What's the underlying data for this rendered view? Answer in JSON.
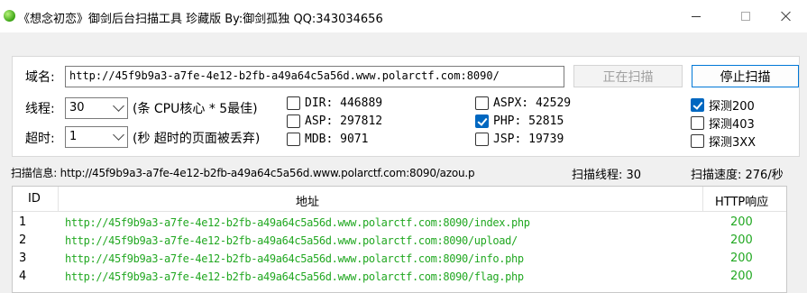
{
  "window": {
    "title": "《想念初恋》御剑后台扫描工具 珍藏版 By:御剑孤独 QQ:343034656"
  },
  "form": {
    "domain_label": "域名:",
    "domain_value": "http://45f9b9a3-a7fe-4e12-b2fb-a49a64c5a56d.www.polarctf.com:8090/",
    "scan_button": "正在扫描",
    "stop_button": "停止扫描",
    "threads_label": "线程:",
    "threads_value": "30",
    "threads_hint": "(条 CPU核心 * 5最佳)",
    "timeout_label": "超时:",
    "timeout_value": "1",
    "timeout_hint": "(秒 超时的页面被丢弃)"
  },
  "dictionaries": [
    {
      "label": "DIR: 446889",
      "checked": false
    },
    {
      "label": "ASP: 297812",
      "checked": false
    },
    {
      "label": "MDB: 9071",
      "checked": false
    },
    {
      "label": "ASPX: 42529",
      "checked": false
    },
    {
      "label": "PHP: 52815",
      "checked": true
    },
    {
      "label": "JSP: 19739",
      "checked": false
    }
  ],
  "probes": [
    {
      "label": "探测200",
      "checked": true
    },
    {
      "label": "探测403",
      "checked": false
    },
    {
      "label": "探测3XX",
      "checked": false
    }
  ],
  "status": {
    "info": "扫描信息: http://45f9b9a3-a7fe-4e12-b2fb-a49a64c5a56d.www.polarctf.com:8090/azou.p",
    "threads": "扫描线程: 30",
    "speed": "扫描速度: 276/秒"
  },
  "results": {
    "columns": [
      "ID",
      "地址",
      "HTTP响应"
    ],
    "rows": [
      {
        "id": "1",
        "url": "http://45f9b9a3-a7fe-4e12-b2fb-a49a64c5a56d.www.polarctf.com:8090/index.php",
        "code": "200"
      },
      {
        "id": "2",
        "url": "http://45f9b9a3-a7fe-4e12-b2fb-a49a64c5a56d.www.polarctf.com:8090/upload/",
        "code": "200"
      },
      {
        "id": "3",
        "url": "http://45f9b9a3-a7fe-4e12-b2fb-a49a64c5a56d.www.polarctf.com:8090/info.php",
        "code": "200"
      },
      {
        "id": "4",
        "url": "http://45f9b9a3-a7fe-4e12-b2fb-a49a64c5a56d.www.polarctf.com:8090/flag.php",
        "code": "200"
      }
    ]
  },
  "colors": {
    "result_text": "#22a822",
    "accent": "#0067c0"
  }
}
